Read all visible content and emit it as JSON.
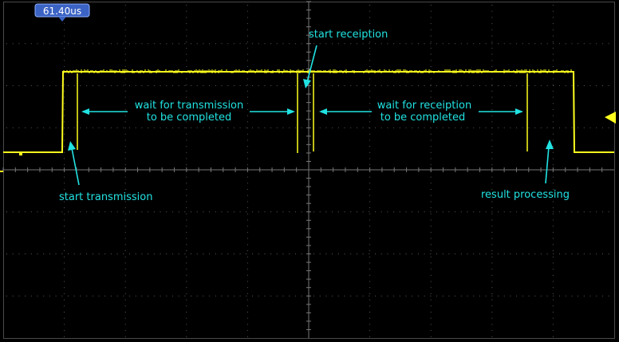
{
  "time_readout": "61.40us",
  "colors": {
    "trace": "#ffff1e",
    "annotation": "#22e2e2",
    "grid": "#5a5a5a",
    "background": "#000000",
    "readout_bg": "#3b63c4",
    "trigger_marker": "#ffff1e"
  },
  "annotations": {
    "start_transmission": "start transmission",
    "wait_tx_line1": "wait for transmission",
    "wait_tx_line2": "to be completed",
    "start_reception": "start receiption",
    "wait_rx_line1": "wait for receiption",
    "wait_rx_line2": "to be completed",
    "result_processing": "result processing"
  },
  "icons": {
    "trigger": "trigger-level-marker-icon",
    "readout_pointer": "time-cursor-pointer-icon"
  }
}
